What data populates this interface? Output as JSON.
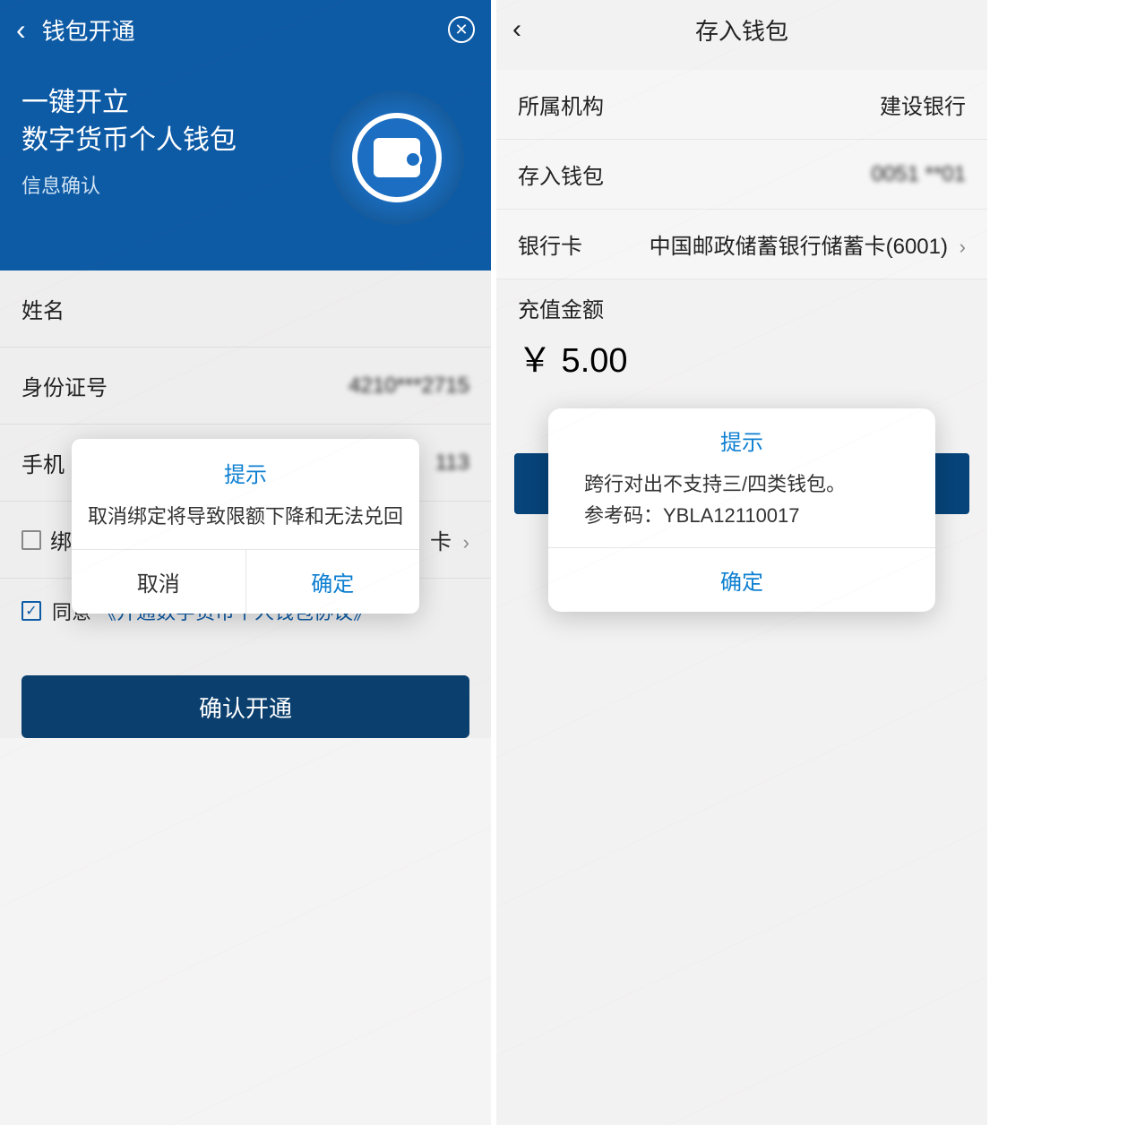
{
  "left": {
    "header": {
      "title": "钱包开通"
    },
    "hero": {
      "line1": "一键开立",
      "line2": "数字货币个人钱包",
      "sub": "信息确认"
    },
    "fields": {
      "name_label": "姓名",
      "id_label": "身份证号",
      "id_value": "4210***2715",
      "phone_label": "手机",
      "phone_value_tail": "113",
      "bind_label": "绑",
      "bind_value_tail": "卡"
    },
    "agree": {
      "label": "同意",
      "link": "《开通数字货币个人钱包协议》"
    },
    "confirm_btn": "确认开通",
    "modal": {
      "title": "提示",
      "message": "取消绑定将导致限额下降和无法兑回",
      "cancel": "取消",
      "ok": "确定"
    }
  },
  "right": {
    "header": {
      "title": "存入钱包"
    },
    "rows": {
      "org_label": "所属机构",
      "org_value": "建设银行",
      "wallet_label": "存入钱包",
      "wallet_value": "0051 **01",
      "card_label": "银行卡",
      "card_value": "中国邮政储蓄银行储蓄卡(6001)"
    },
    "amount_label": "充值金额",
    "amount_value": "￥ 5.00",
    "modal": {
      "title": "提示",
      "msg_line1": "跨行对出不支持三/四类钱包。",
      "msg_line2": "参考码：YBLA12110017",
      "ok": "确定"
    }
  }
}
